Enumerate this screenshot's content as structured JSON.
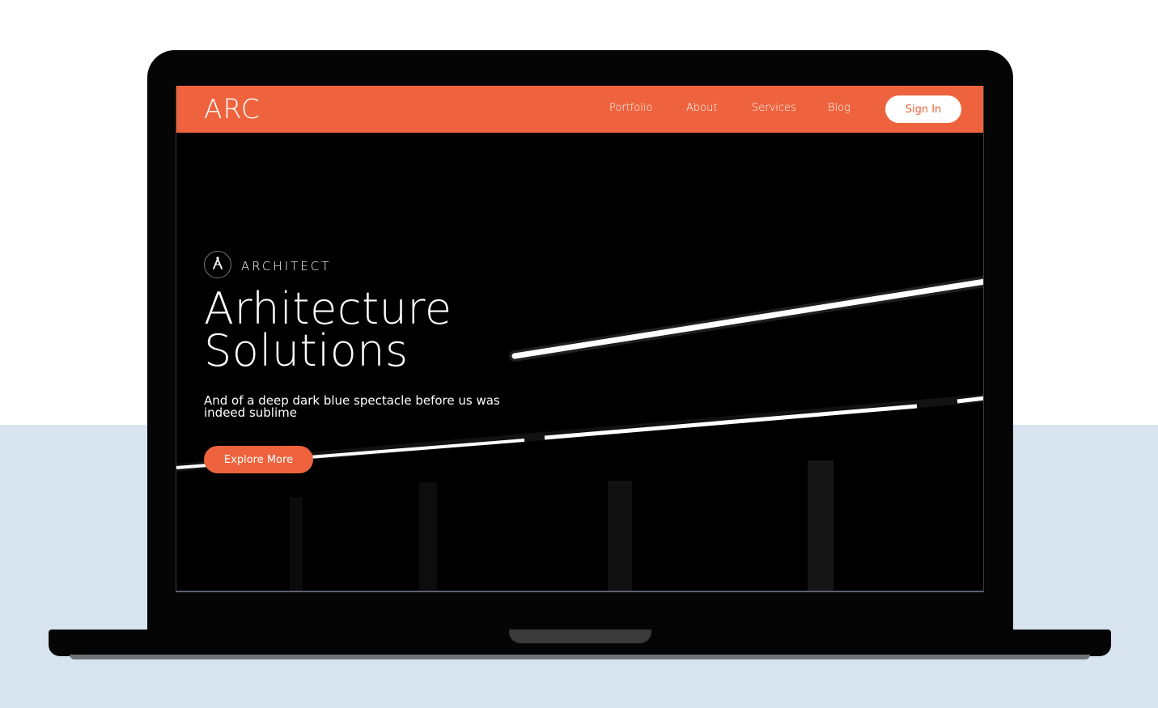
{
  "navbar": {
    "logo": "ARC",
    "links": [
      "Portfolio",
      "About",
      "Services",
      "Blog"
    ],
    "signin_label": "Sign In"
  },
  "hero": {
    "eyebrow": "ARCHITECT",
    "headline_line1": "Arhitecture",
    "headline_line2": "Solutions",
    "subtext_line1": "And of a deep dark blue spectacle before us was",
    "subtext_line2": "indeed sublime",
    "cta_label": "Explore More"
  },
  "colors": {
    "accent": "#ee633d",
    "page_top": "#ffffff",
    "page_bottom": "#d7e4f0",
    "device": "#050505"
  },
  "icons": {
    "badge": "compass-icon"
  }
}
